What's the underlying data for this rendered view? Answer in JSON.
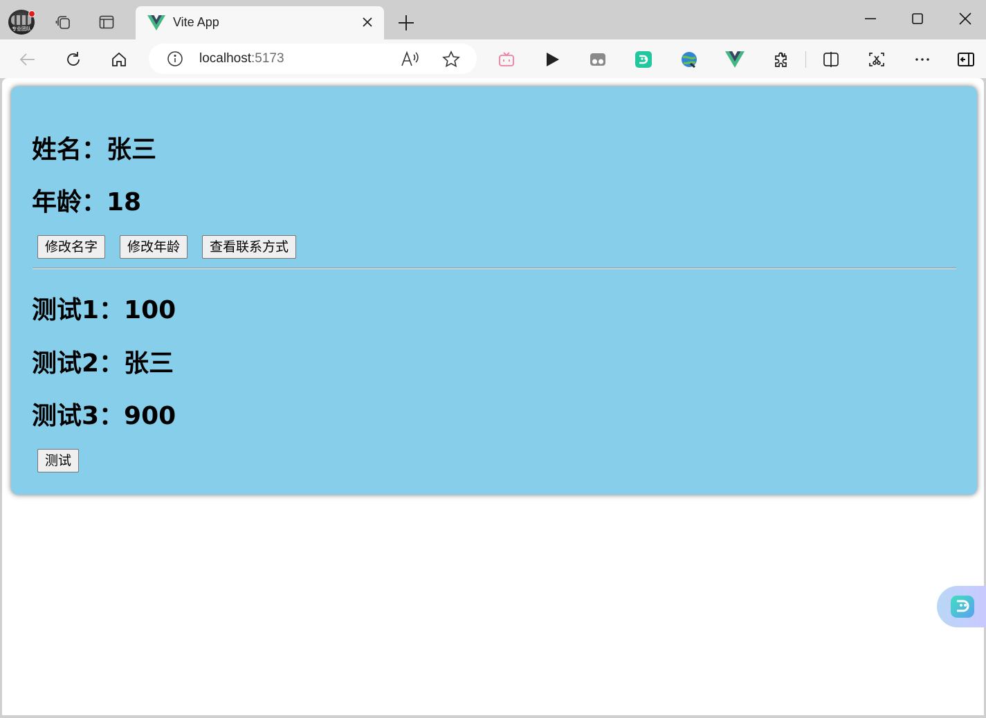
{
  "browser": {
    "avatar_caption": "专业团队",
    "tab": {
      "title": "Vite App"
    },
    "address": {
      "host": "localhost",
      "port": ":5173"
    }
  },
  "app": {
    "name_label": "姓名：张三",
    "age_label": "年龄：18",
    "buttons": {
      "change_name": "修改名字",
      "change_age": "修改年龄",
      "view_contact": "查看联系方式",
      "test": "测试"
    },
    "test1": "测试1：100",
    "test2": "测试2：张三",
    "test3": "测试3：900"
  },
  "colors": {
    "card_bg": "#87ceeb",
    "vue_green": "#41b883",
    "vue_dark": "#35495e"
  }
}
